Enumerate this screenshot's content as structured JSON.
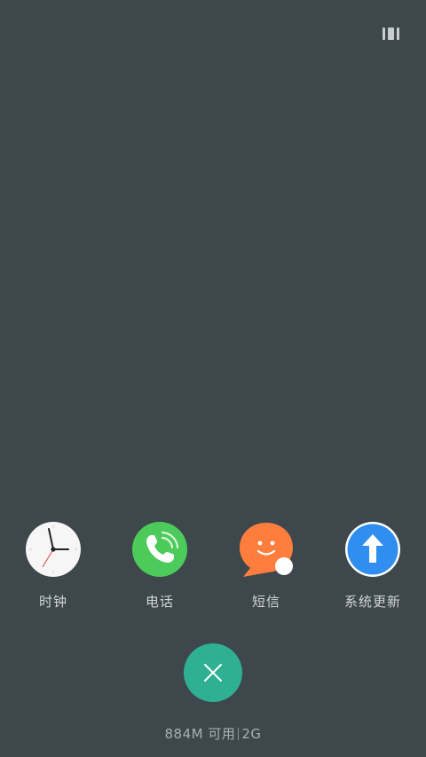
{
  "apps": [
    {
      "name": "clock",
      "label": "时钟",
      "icon": "clock-icon"
    },
    {
      "name": "phone",
      "label": "电话",
      "icon": "phone-icon"
    },
    {
      "name": "messages",
      "label": "短信",
      "icon": "message-icon"
    },
    {
      "name": "system-update",
      "label": "系统更新",
      "icon": "update-arrow-icon"
    }
  ],
  "memory": {
    "available": "884M 可用",
    "total": "2G"
  },
  "colors": {
    "background": "#3d474c",
    "close_button": "#2fb093",
    "phone_green": "#4ccb5a",
    "message_orange": "#ff7d3d",
    "update_blue": "#2f8ef0"
  },
  "controls": {
    "close_icon": "close-icon",
    "recent_view_icon": "view-toggle-icon"
  }
}
